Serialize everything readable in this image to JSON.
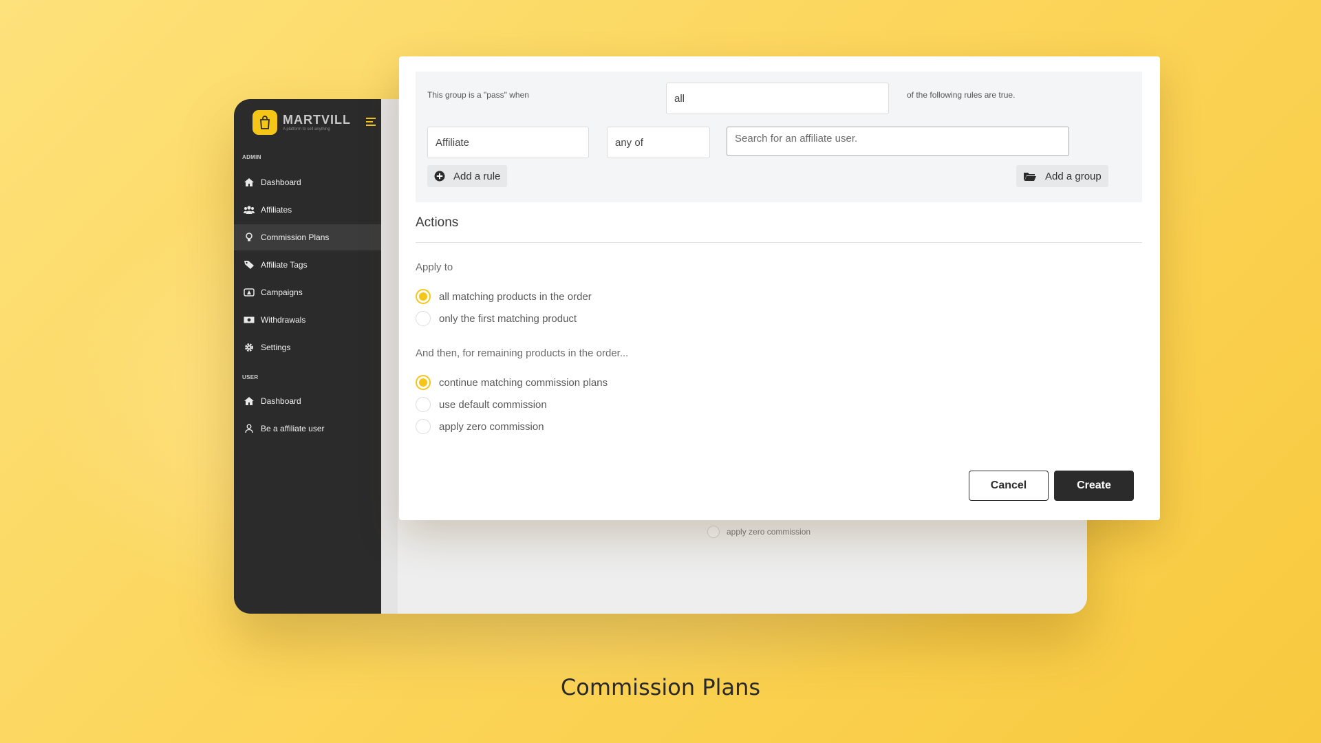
{
  "brand": {
    "name": "MARTVILL",
    "tagline": "A platform to sell anything",
    "accent": "#f5c518"
  },
  "sidebar": {
    "admin_label": "ADMIN",
    "admin_items": [
      {
        "label": "Dashboard",
        "icon": "home-icon"
      },
      {
        "label": "Affiliates",
        "icon": "users-icon"
      },
      {
        "label": "Commission Plans",
        "icon": "lightbulb-icon",
        "active": true
      },
      {
        "label": "Affiliate Tags",
        "icon": "tag-icon"
      },
      {
        "label": "Campaigns",
        "icon": "campaign-icon"
      },
      {
        "label": "Withdrawals",
        "icon": "money-icon"
      },
      {
        "label": "Settings",
        "icon": "gear-icon"
      }
    ],
    "user_label": "USER",
    "user_items": [
      {
        "label": "Dashboard",
        "icon": "home-icon"
      },
      {
        "label": "Be a affiliate user",
        "icon": "user-icon"
      }
    ]
  },
  "background_main": {
    "ghost_option": "apply zero commission"
  },
  "modal": {
    "group": {
      "pass_label": "This group is a \"pass\" when",
      "pass_value": "all",
      "rules_label": "of the following rules are true.",
      "rule_field": "Affiliate",
      "rule_operator": "any of",
      "search_placeholder": "Search for an affiliate user.",
      "add_rule": "Add a rule",
      "add_group": "Add a group"
    },
    "actions": {
      "title": "Actions",
      "apply_to_label": "Apply to",
      "apply_to_options": [
        {
          "label": "all matching products in the order",
          "checked": true
        },
        {
          "label": "only the first matching product",
          "checked": false
        }
      ],
      "remaining_label": "And then, for remaining products in the order...",
      "remaining_options": [
        {
          "label": "continue matching commission plans",
          "checked": true
        },
        {
          "label": "use default commission",
          "checked": false
        },
        {
          "label": "apply zero commission",
          "checked": false
        }
      ]
    },
    "buttons": {
      "cancel": "Cancel",
      "create": "Create"
    }
  },
  "caption": "Commission Plans"
}
